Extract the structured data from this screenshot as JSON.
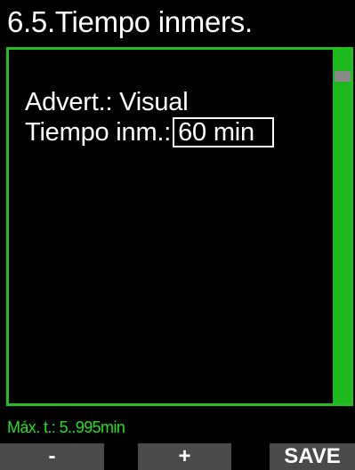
{
  "header": {
    "title": "6.5.Tiempo inmers."
  },
  "settings": {
    "warning_label": "Advert.: Visual",
    "time_label": "Tiempo inm.:",
    "time_value": "60 min"
  },
  "status": {
    "range_text": "Máx. t.: 5..995min"
  },
  "softkeys": {
    "minus_label": "-",
    "plus_label": "+",
    "save_label": "SAVE"
  },
  "colors": {
    "accent": "#1fc01f",
    "status_text": "#22e022",
    "softkey_bg": "#4a4a4a",
    "background": "#000000"
  },
  "icons": {
    "scrollbar": "vertical-scrollbar"
  }
}
